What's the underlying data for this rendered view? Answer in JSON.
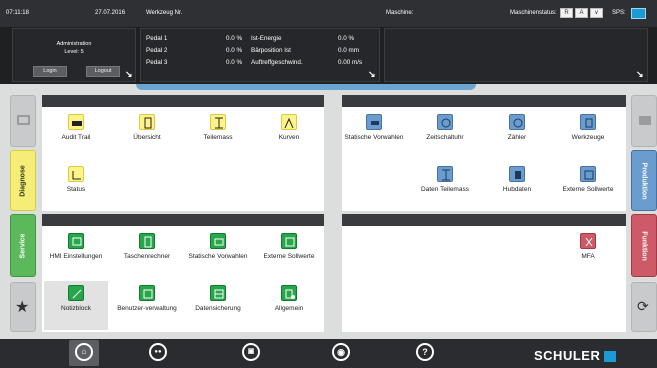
{
  "status_bar": {
    "time": "07:11:18",
    "date": "27.07.2016",
    "tool_label": "Werkzeug Nr.",
    "machine_label": "Maschine:",
    "machine_status_label": "Maschinenstatus:",
    "sps_label": "SPS:",
    "status_icons": [
      "R",
      "A",
      "∨"
    ]
  },
  "login_panel": {
    "user": "Administration",
    "level": "Level: 5",
    "login_label": "Login",
    "logout_label": "Logout"
  },
  "pedal_panel": {
    "rows": [
      {
        "name": "Pedal 1",
        "value": "0.0 %",
        "label": "Ist-Energie",
        "reading": "0.0 %"
      },
      {
        "name": "Pedal 2",
        "value": "0.0 %",
        "label": "Bärposition Ist",
        "reading": "0.0 mm"
      },
      {
        "name": "Pedal 3",
        "value": "0.0 %",
        "label": "Auftreffgeschwind.",
        "reading": "0.00 m/s"
      }
    ]
  },
  "side_tabs": {
    "diagnose": "Diagnose",
    "service": "Service",
    "produktion": "Produktion",
    "funktion": "Funktion"
  },
  "diagnose_tiles": [
    "Audit Trail",
    "Übersicht",
    "Teilemass",
    "Kurven",
    "Status"
  ],
  "produktion_tiles": [
    "Statische Vorwahlen",
    "Zeitschaltuhr",
    "Zähler",
    "Werkzeuge",
    "Daten Teilemass",
    "Hubdaten",
    "Externe Sollwerte"
  ],
  "service_tiles": [
    "HMI Einstellungen",
    "Taschenrechner",
    "Statische Vorwahlen",
    "Externe Sollwerte",
    "Notizblock",
    "Benutzer-verwaltung",
    "Datensicherung",
    "Allgemein"
  ],
  "funktion_tiles": [
    "MFA"
  ],
  "bottom_nav": [
    "home-icon",
    "menu-grid-icon",
    "network-icon",
    "globe-icon",
    "help-icon"
  ],
  "help_symbol": "?",
  "logo_text": "SCHULER",
  "colors": {
    "diagnose": "#f6ec78",
    "service": "#5bb95c",
    "produktion": "#6a9ccf",
    "funktion": "#cd5a66",
    "sps": "#1c9ad6"
  }
}
